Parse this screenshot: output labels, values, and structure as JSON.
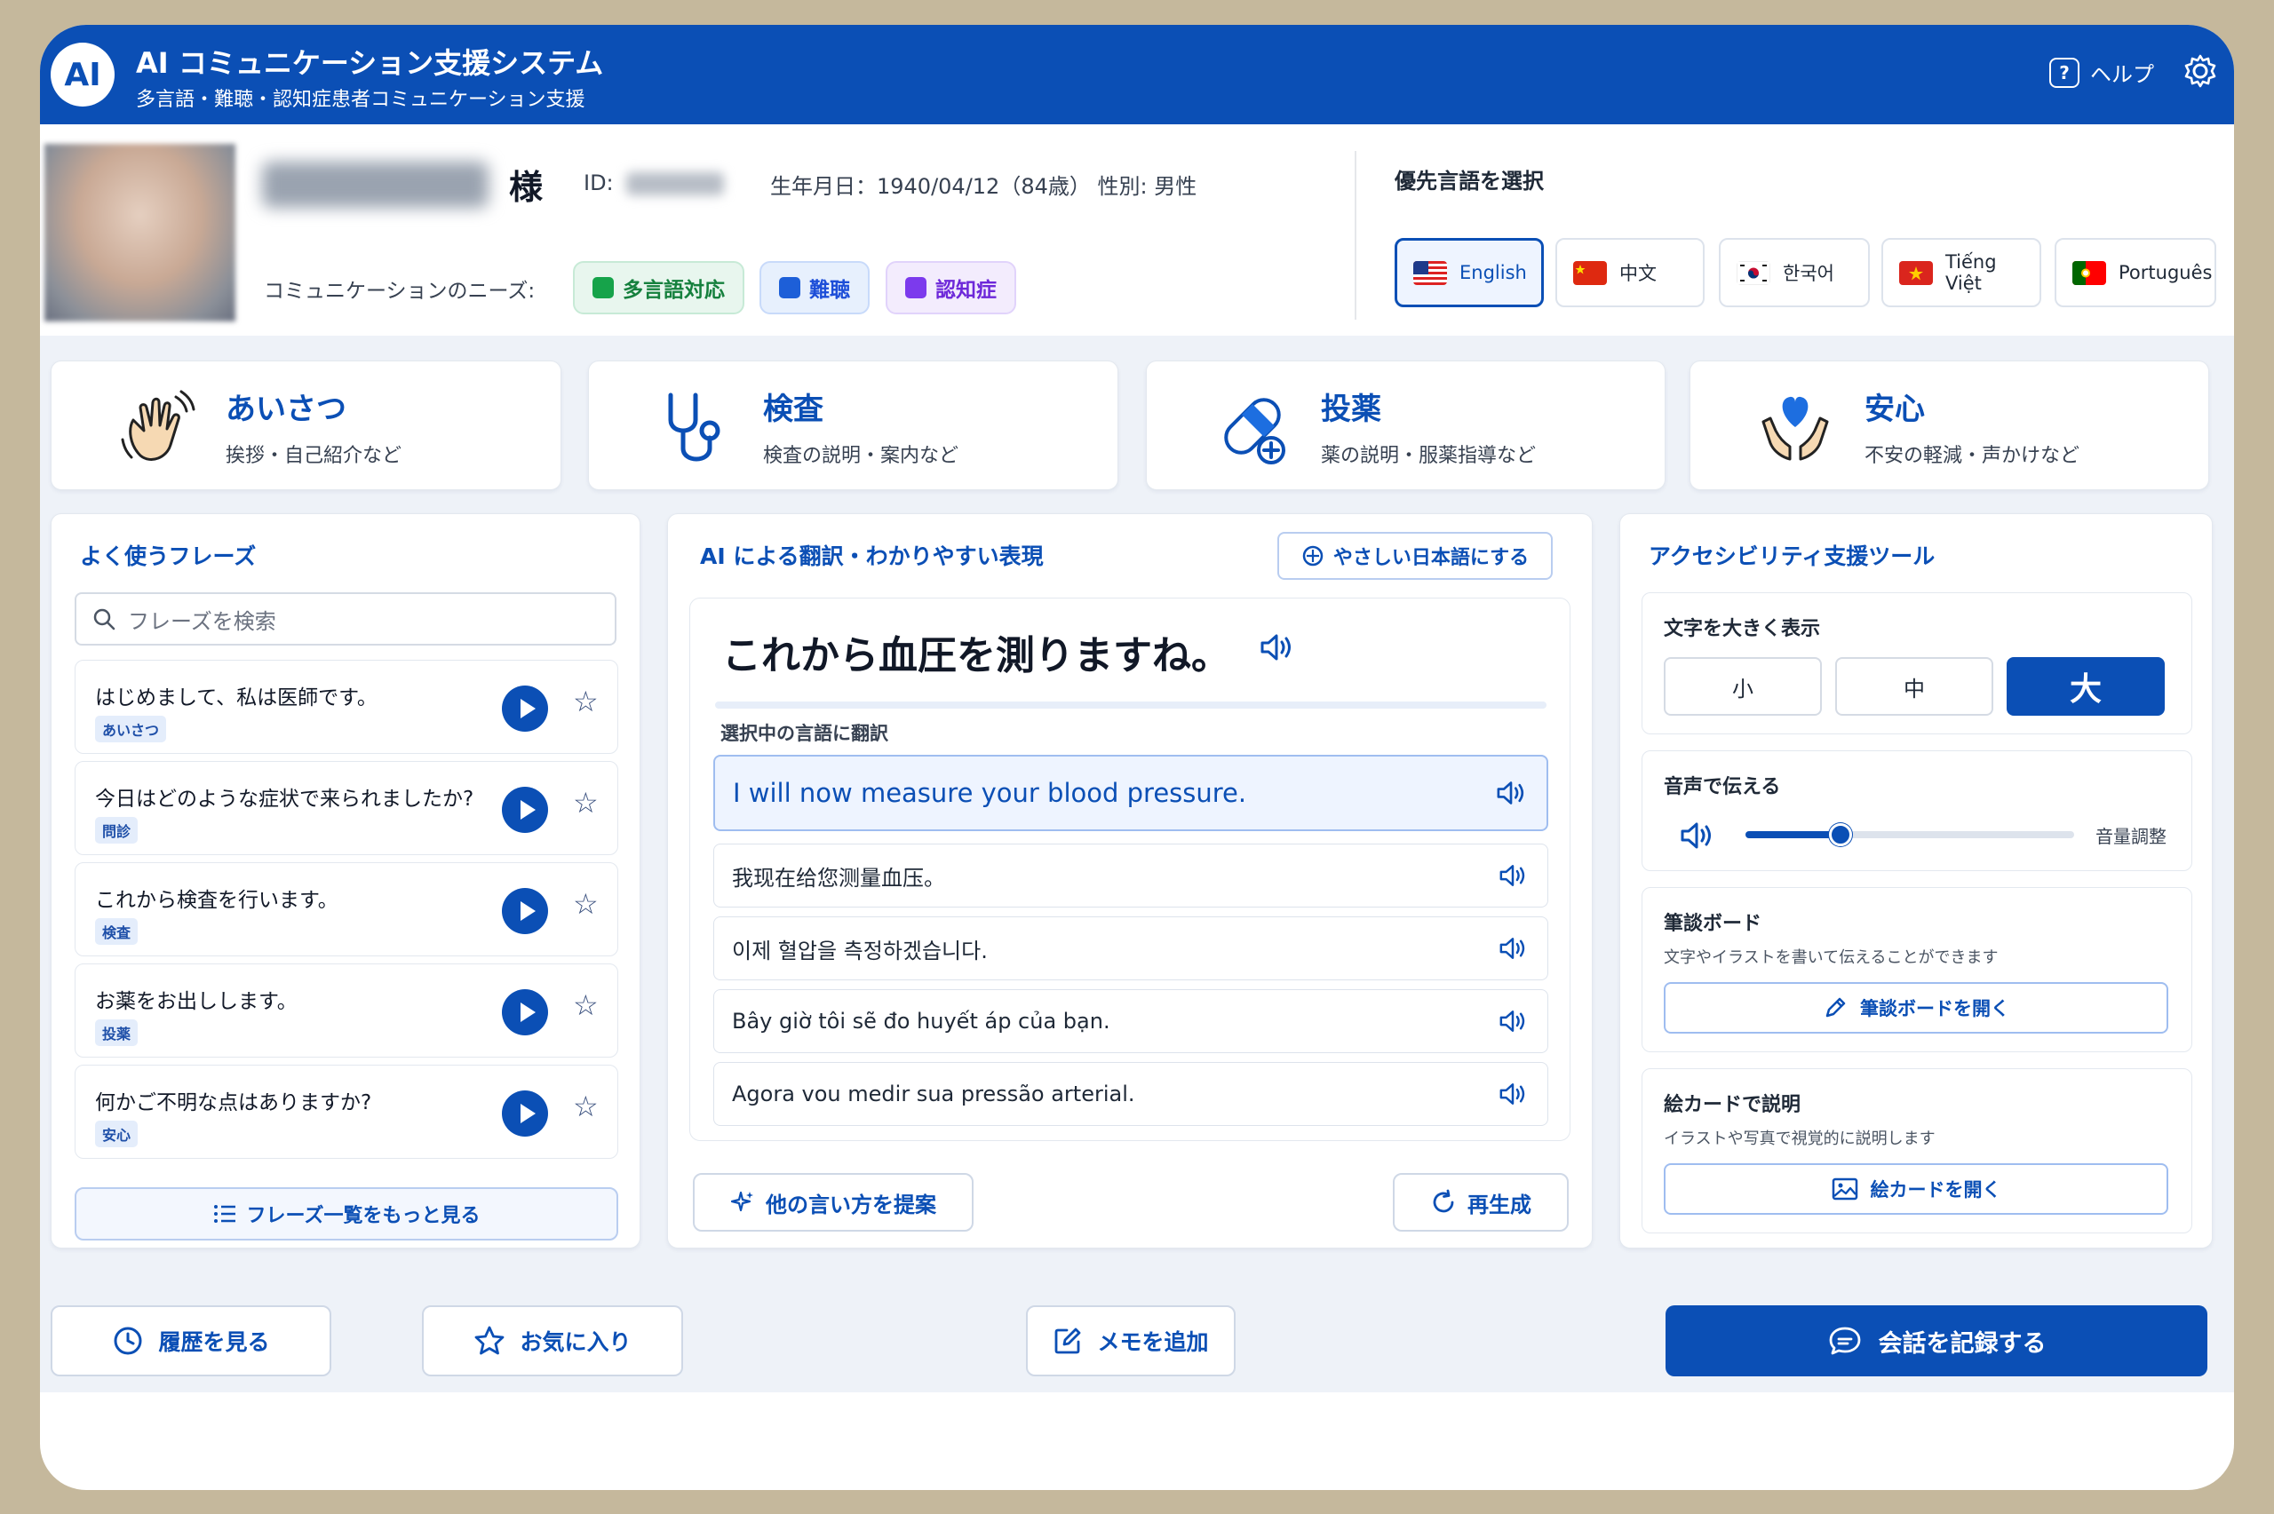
{
  "header": {
    "logo": "AI",
    "title": "AI コミュニケーション支援システム",
    "subtitle": "多言語・難聴・認知症患者コミュニケーション支援",
    "help_label": "ヘルプ",
    "help_icon": "question-icon",
    "settings_icon": "gear-icon"
  },
  "patient": {
    "honorific": "様",
    "id_label": "ID:",
    "birth_info": "生年月日：1940/04/12（84歳） 性別: 男性",
    "needs_label": "コミュニケーションのニーズ:",
    "needs": [
      {
        "label": "多言語対応",
        "color": "#16a34a"
      },
      {
        "label": "難聴",
        "color": "#1d5fd8"
      },
      {
        "label": "認知症",
        "color": "#7c3aed"
      }
    ]
  },
  "language": {
    "title": "優先言語を選択",
    "options": [
      {
        "label": "English",
        "selected": true
      },
      {
        "label": "中文",
        "selected": false
      },
      {
        "label": "한국어",
        "selected": false
      },
      {
        "label": "Tiếng Việt",
        "selected": false
      },
      {
        "label": "Português",
        "selected": false
      }
    ]
  },
  "categories": [
    {
      "title": "あいさつ",
      "subtitle": "挨拶・自己紹介など",
      "icon": "waving-hand-icon"
    },
    {
      "title": "検査",
      "subtitle": "検査の説明・案内など",
      "icon": "stethoscope-icon"
    },
    {
      "title": "投薬",
      "subtitle": "薬の説明・服薬指導など",
      "icon": "pill-icon"
    },
    {
      "title": "安心",
      "subtitle": "不安の軽減・声かけなど",
      "icon": "heart-hands-icon"
    }
  ],
  "phrases": {
    "title": "よく使うフレーズ",
    "search_placeholder": "フレーズを検索",
    "items": [
      {
        "text": "はじめまして、私は医師です。",
        "tag": "あいさつ"
      },
      {
        "text": "今日はどのような症状で来られましたか?",
        "tag": "問診"
      },
      {
        "text": "これから検査を行います。",
        "tag": "検査"
      },
      {
        "text": "お薬をお出しします。",
        "tag": "投薬"
      },
      {
        "text": "何かご不明な点はありますか?",
        "tag": "安心"
      }
    ],
    "more_label": "フレーズ一覧をもっと見る"
  },
  "translation": {
    "title": "AI による翻訳・わかりやすい表現",
    "simplify_label": "やさしい日本語にする",
    "source_text": "これから血圧を測りますね。",
    "selected_label": "選択中の言語に翻訳",
    "results": [
      "I will now measure your blood pressure.",
      "我现在给您测量血压。",
      "이제 혈압을 측정하겠습니다.",
      "Bây giờ tôi sẽ đo huyết áp của bạn.",
      "Agora vou medir sua pressão arterial."
    ],
    "suggest_label": "他の言い方を提案",
    "regenerate_label": "再生成"
  },
  "accessibility": {
    "title": "アクセシビリティ支援ツール",
    "text_size": {
      "title": "文字を大きく表示",
      "options": [
        "小",
        "中",
        "大"
      ],
      "selected_index": 2
    },
    "voice": {
      "title": "音声で伝える",
      "volume_label": "音量調整",
      "volume_level": 0.29
    },
    "board": {
      "title": "筆談ボード",
      "desc": "文字やイラストを書いて伝えることができます",
      "button": "筆談ボードを開く"
    },
    "cards": {
      "title": "絵カードで説明",
      "desc": "イラストや写真で視覚的に説明します",
      "button": "絵カードを開く"
    }
  },
  "footer": {
    "history": "履歴を見る",
    "favorites": "お気に入り",
    "memo": "メモを追加",
    "record": "会話を記録する"
  },
  "colors": {
    "primary": "#0b4fb5",
    "frame": "#c5b89c",
    "band": "#eef2f8"
  }
}
